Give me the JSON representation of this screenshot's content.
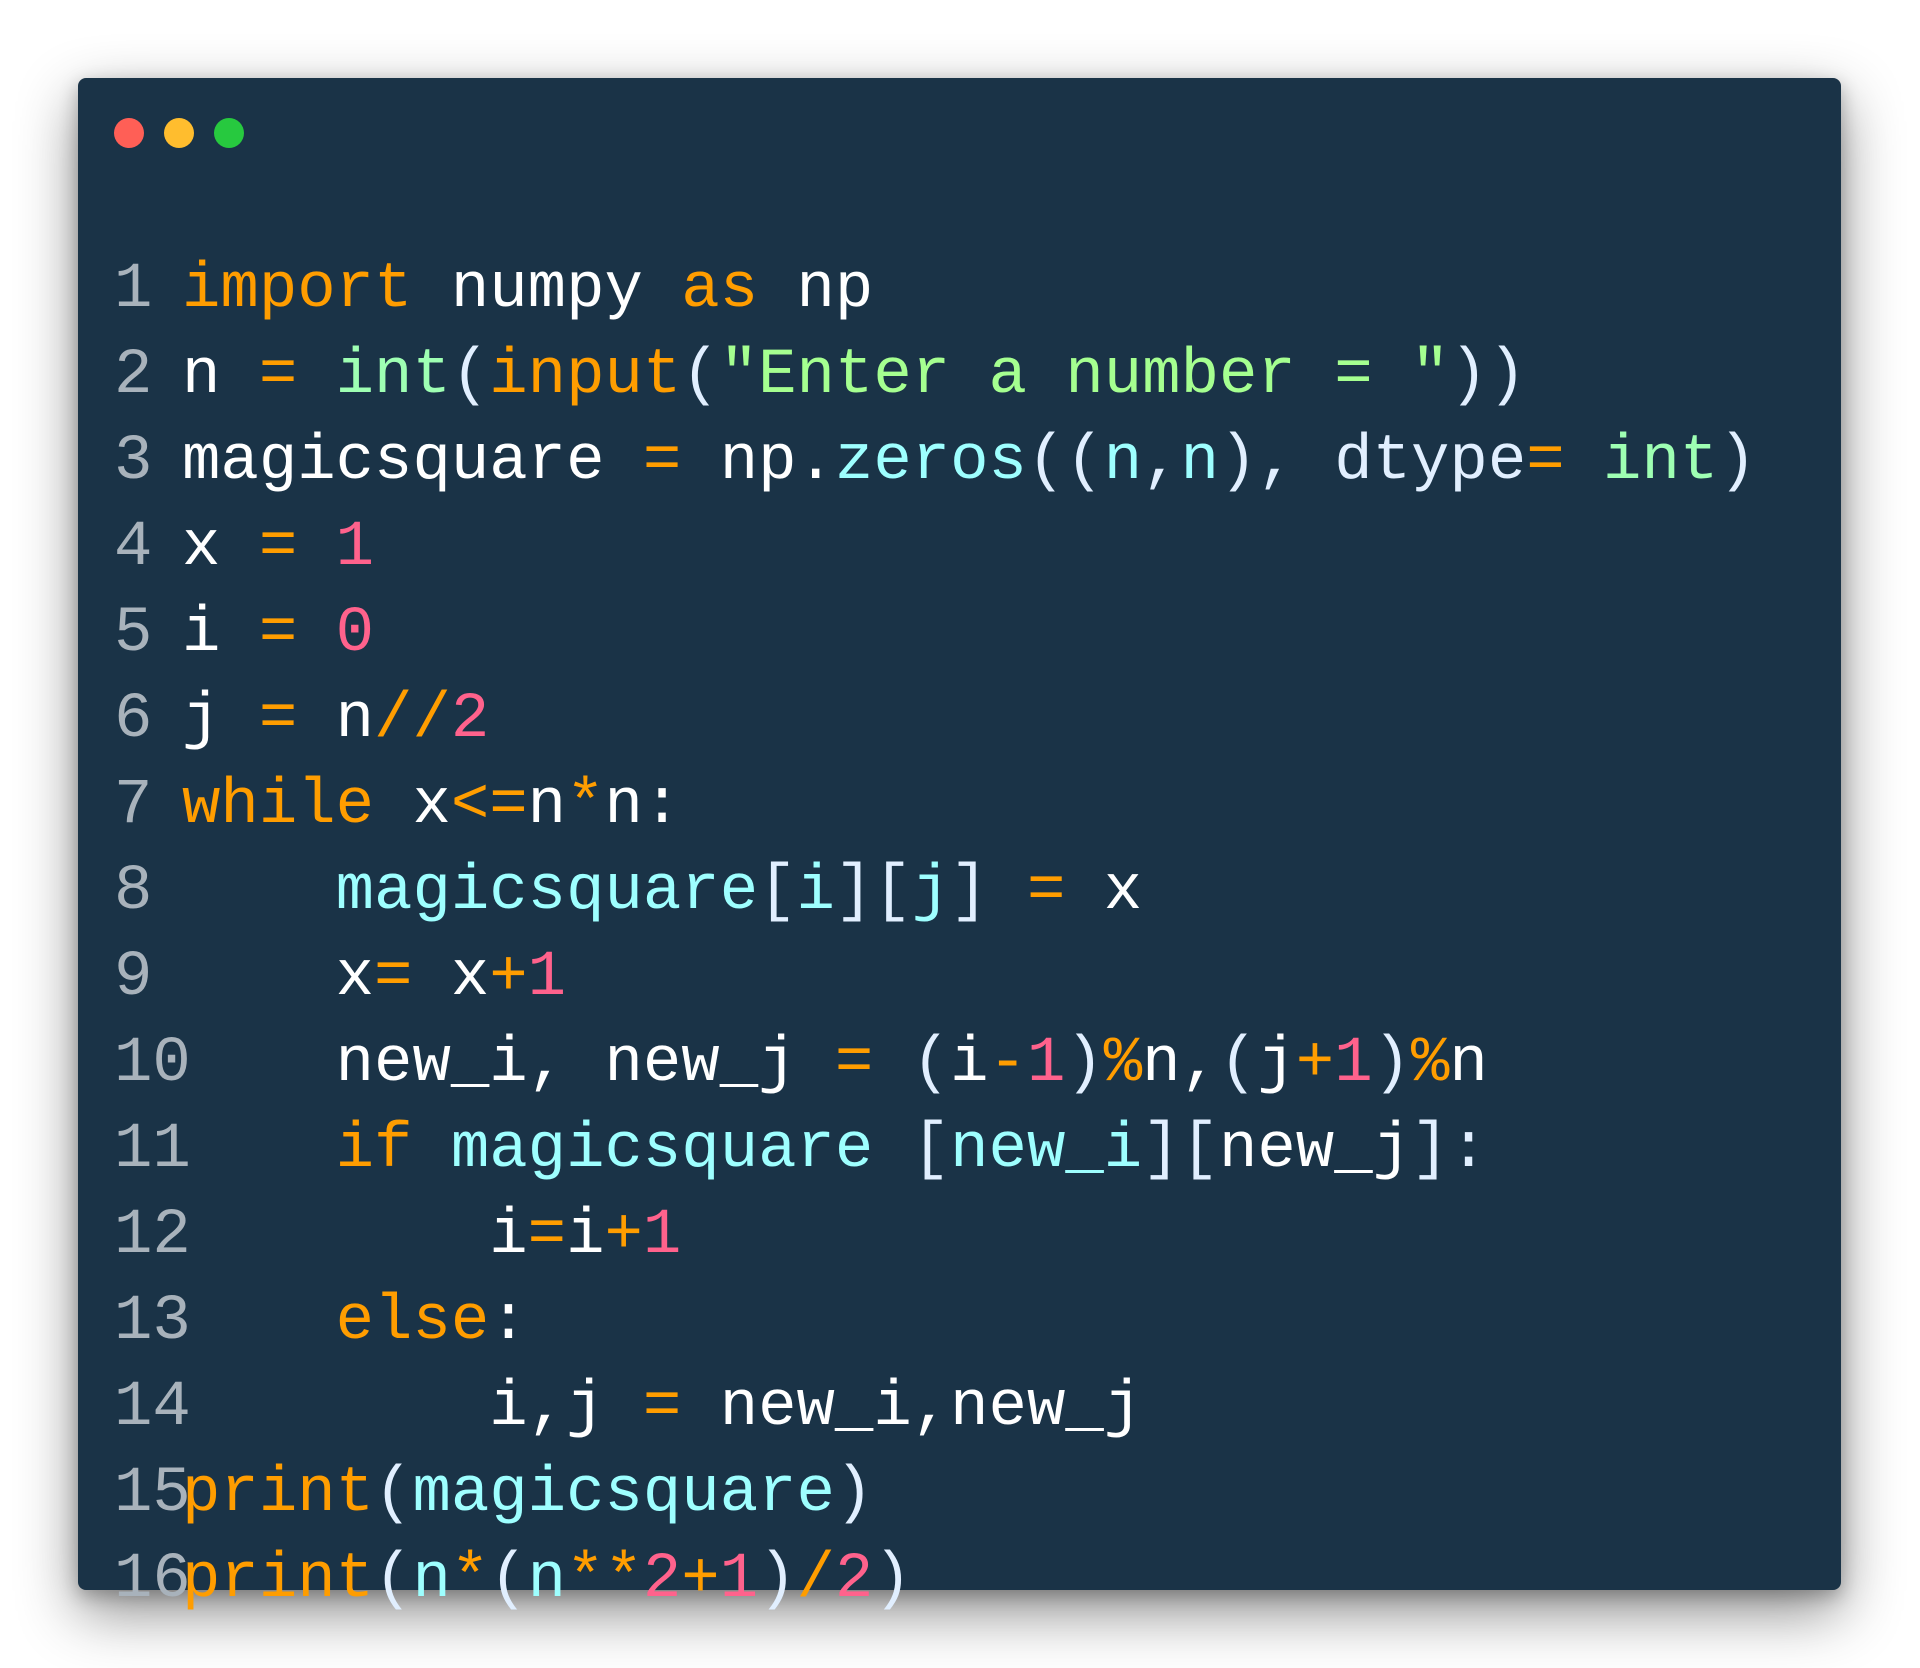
{
  "window": {
    "controls": [
      "close",
      "minimize",
      "maximize"
    ],
    "colors": {
      "background": "#1a3347",
      "close": "#ff5f56",
      "minimize": "#ffbd2e",
      "maximize": "#27c93f"
    }
  },
  "code": {
    "language": "python",
    "lines": [
      {
        "number": "1",
        "tokens": [
          {
            "t": "import",
            "c": "kw"
          },
          {
            "t": " numpy ",
            "c": "plain"
          },
          {
            "t": "as",
            "c": "kw"
          },
          {
            "t": " np",
            "c": "plain"
          }
        ]
      },
      {
        "number": "2",
        "tokens": [
          {
            "t": "n ",
            "c": "plain"
          },
          {
            "t": "=",
            "c": "op"
          },
          {
            "t": " ",
            "c": "plain"
          },
          {
            "t": "int",
            "c": "fn"
          },
          {
            "t": "(",
            "c": "punc"
          },
          {
            "t": "input",
            "c": "kw"
          },
          {
            "t": "(",
            "c": "punc"
          },
          {
            "t": "\"Enter a number = \"",
            "c": "str"
          },
          {
            "t": "))",
            "c": "punc"
          }
        ]
      },
      {
        "number": "3",
        "tokens": [
          {
            "t": "magicsquare ",
            "c": "plain"
          },
          {
            "t": "=",
            "c": "op"
          },
          {
            "t": " np.",
            "c": "plain"
          },
          {
            "t": "zeros",
            "c": "var"
          },
          {
            "t": "((",
            "c": "punc"
          },
          {
            "t": "n",
            "c": "var"
          },
          {
            "t": ",",
            "c": "punc"
          },
          {
            "t": "n",
            "c": "var"
          },
          {
            "t": "), ",
            "c": "punc"
          },
          {
            "t": "dtype",
            "c": "punc"
          },
          {
            "t": "=",
            "c": "op"
          },
          {
            "t": " ",
            "c": "plain"
          },
          {
            "t": "int",
            "c": "fn"
          },
          {
            "t": ")",
            "c": "punc"
          }
        ]
      },
      {
        "number": "4",
        "tokens": [
          {
            "t": "x ",
            "c": "plain"
          },
          {
            "t": "=",
            "c": "op"
          },
          {
            "t": " ",
            "c": "plain"
          },
          {
            "t": "1",
            "c": "num"
          }
        ]
      },
      {
        "number": "5",
        "tokens": [
          {
            "t": "i ",
            "c": "plain"
          },
          {
            "t": "=",
            "c": "op"
          },
          {
            "t": " ",
            "c": "plain"
          },
          {
            "t": "0",
            "c": "num"
          }
        ]
      },
      {
        "number": "6",
        "tokens": [
          {
            "t": "j ",
            "c": "plain"
          },
          {
            "t": "=",
            "c": "op"
          },
          {
            "t": " n",
            "c": "plain"
          },
          {
            "t": "//",
            "c": "op"
          },
          {
            "t": "2",
            "c": "num"
          }
        ]
      },
      {
        "number": "7",
        "tokens": [
          {
            "t": "while",
            "c": "kw"
          },
          {
            "t": " x",
            "c": "plain"
          },
          {
            "t": "<=",
            "c": "op"
          },
          {
            "t": "n",
            "c": "plain"
          },
          {
            "t": "*",
            "c": "op"
          },
          {
            "t": "n:",
            "c": "plain"
          }
        ]
      },
      {
        "number": "8",
        "tokens": [
          {
            "t": "    ",
            "c": "plain"
          },
          {
            "t": "magicsquare",
            "c": "var"
          },
          {
            "t": "[",
            "c": "punc"
          },
          {
            "t": "i",
            "c": "var"
          },
          {
            "t": "][",
            "c": "punc"
          },
          {
            "t": "j",
            "c": "var"
          },
          {
            "t": "] ",
            "c": "punc"
          },
          {
            "t": "=",
            "c": "op"
          },
          {
            "t": " x",
            "c": "plain"
          }
        ]
      },
      {
        "number": "9",
        "tokens": [
          {
            "t": "    x",
            "c": "plain"
          },
          {
            "t": "=",
            "c": "op"
          },
          {
            "t": " x",
            "c": "plain"
          },
          {
            "t": "+",
            "c": "op"
          },
          {
            "t": "1",
            "c": "num"
          }
        ]
      },
      {
        "number": "10",
        "tokens": [
          {
            "t": "    new_i, new_j ",
            "c": "plain"
          },
          {
            "t": "=",
            "c": "op"
          },
          {
            "t": " (",
            "c": "punc"
          },
          {
            "t": "i",
            "c": "plain"
          },
          {
            "t": "-",
            "c": "op"
          },
          {
            "t": "1",
            "c": "num"
          },
          {
            "t": ")",
            "c": "punc"
          },
          {
            "t": "%",
            "c": "op"
          },
          {
            "t": "n,",
            "c": "plain"
          },
          {
            "t": "(",
            "c": "punc"
          },
          {
            "t": "j",
            "c": "plain"
          },
          {
            "t": "+",
            "c": "op"
          },
          {
            "t": "1",
            "c": "num"
          },
          {
            "t": ")",
            "c": "punc"
          },
          {
            "t": "%",
            "c": "op"
          },
          {
            "t": "n",
            "c": "plain"
          }
        ]
      },
      {
        "number": "11",
        "tokens": [
          {
            "t": "    ",
            "c": "plain"
          },
          {
            "t": "if",
            "c": "kw"
          },
          {
            "t": " ",
            "c": "plain"
          },
          {
            "t": "magicsquare",
            "c": "var"
          },
          {
            "t": " [",
            "c": "punc"
          },
          {
            "t": "new_i",
            "c": "var"
          },
          {
            "t": "][",
            "c": "punc"
          },
          {
            "t": "new_j",
            "c": "plain"
          },
          {
            "t": "]:",
            "c": "punc"
          }
        ]
      },
      {
        "number": "12",
        "tokens": [
          {
            "t": "        i",
            "c": "plain"
          },
          {
            "t": "=",
            "c": "op"
          },
          {
            "t": "i",
            "c": "plain"
          },
          {
            "t": "+",
            "c": "op"
          },
          {
            "t": "1",
            "c": "num"
          }
        ]
      },
      {
        "number": "13",
        "tokens": [
          {
            "t": "    ",
            "c": "plain"
          },
          {
            "t": "else",
            "c": "kw"
          },
          {
            "t": ":",
            "c": "plain"
          }
        ]
      },
      {
        "number": "14",
        "tokens": [
          {
            "t": "        i,j ",
            "c": "plain"
          },
          {
            "t": "=",
            "c": "op"
          },
          {
            "t": " new_i,new_j",
            "c": "plain"
          }
        ]
      },
      {
        "number": "15",
        "tokens": [
          {
            "t": "print",
            "c": "kw"
          },
          {
            "t": "(",
            "c": "punc"
          },
          {
            "t": "magicsquare",
            "c": "var"
          },
          {
            "t": ")",
            "c": "punc"
          }
        ]
      },
      {
        "number": "16",
        "tokens": [
          {
            "t": "print",
            "c": "kw"
          },
          {
            "t": "(",
            "c": "punc"
          },
          {
            "t": "n",
            "c": "var"
          },
          {
            "t": "*",
            "c": "op"
          },
          {
            "t": "(",
            "c": "punc"
          },
          {
            "t": "n",
            "c": "var"
          },
          {
            "t": "**",
            "c": "op"
          },
          {
            "t": "2",
            "c": "num"
          },
          {
            "t": "+",
            "c": "op"
          },
          {
            "t": "1",
            "c": "num"
          },
          {
            "t": ")",
            "c": "punc"
          },
          {
            "t": "/",
            "c": "op"
          },
          {
            "t": "2",
            "c": "num"
          },
          {
            "t": ")",
            "c": "punc"
          }
        ]
      }
    ]
  }
}
